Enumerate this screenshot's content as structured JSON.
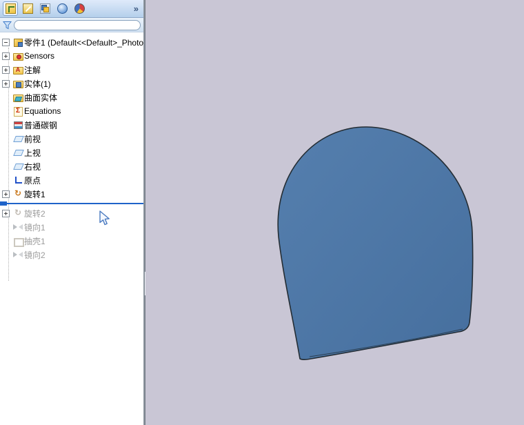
{
  "manager_panel": {
    "tabs": [
      {
        "name": "featuremanager-design-tree",
        "active": true
      },
      {
        "name": "propertymanager",
        "active": false
      },
      {
        "name": "configurationmanager",
        "active": false
      },
      {
        "name": "dimxpertmanager",
        "active": false
      },
      {
        "name": "displaymanager",
        "active": false
      }
    ],
    "overflow_chevron": "»",
    "filter": {
      "value": "",
      "placeholder": ""
    },
    "tree": {
      "root_label": "零件1 (Default<<Default>_Photo",
      "items": [
        {
          "label": "Sensors",
          "icon": "sensors",
          "expandable": true,
          "rolled_back": false
        },
        {
          "label": "注解",
          "icon": "annotations",
          "expandable": true,
          "rolled_back": false
        },
        {
          "label": "实体(1)",
          "icon": "solid-bodies",
          "expandable": true,
          "rolled_back": false
        },
        {
          "label": "曲面实体",
          "icon": "surface-bodies",
          "expandable": false,
          "rolled_back": false
        },
        {
          "label": "Equations",
          "icon": "equations",
          "expandable": false,
          "rolled_back": false
        },
        {
          "label": "普通碳钢",
          "icon": "material",
          "expandable": false,
          "rolled_back": false
        },
        {
          "label": "前视",
          "icon": "plane",
          "expandable": false,
          "rolled_back": false
        },
        {
          "label": "上视",
          "icon": "plane",
          "expandable": false,
          "rolled_back": false
        },
        {
          "label": "右视",
          "icon": "plane",
          "expandable": false,
          "rolled_back": false
        },
        {
          "label": "原点",
          "icon": "origin",
          "expandable": false,
          "rolled_back": false
        },
        {
          "label": "旋转1",
          "icon": "revolve",
          "expandable": true,
          "rolled_back": false
        },
        {
          "rollback_bar": true
        },
        {
          "label": "旋转2",
          "icon": "revolve",
          "expandable": true,
          "rolled_back": true
        },
        {
          "label": "镜向1",
          "icon": "mirror",
          "expandable": false,
          "rolled_back": true
        },
        {
          "label": "抽壳1",
          "icon": "shell",
          "expandable": false,
          "rolled_back": true
        },
        {
          "label": "镜向2",
          "icon": "mirror",
          "expandable": false,
          "rolled_back": true
        }
      ]
    }
  },
  "viewport": {
    "background_color": "#c9c6d5",
    "model": {
      "name": "dome-solid",
      "fill_start": "#557fae",
      "fill_end": "#466f9e",
      "outline": "#242d34"
    }
  },
  "cursor": {
    "visible": true
  }
}
